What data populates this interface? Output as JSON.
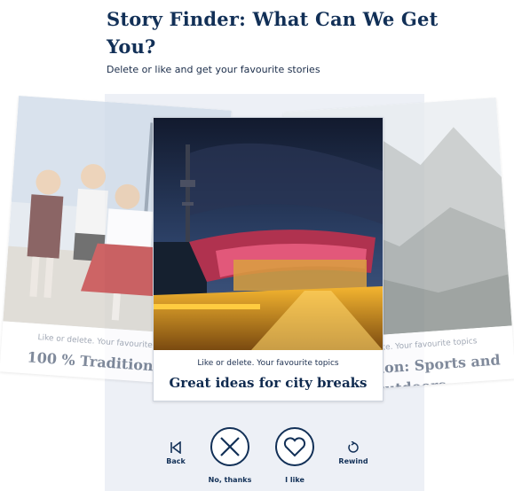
{
  "header": {
    "title": "Story Finder: What Can We Get You?",
    "subtitle": "Delete or like and get your favourite stories"
  },
  "cards": {
    "left": {
      "kicker": "Like or delete. Your favourite topics",
      "topic": "100 % Tradition"
    },
    "center": {
      "kicker": "Like or delete. Your favourite topics",
      "topic": "Great ideas for city breaks"
    },
    "right": {
      "kicker": "Like or delete. Your favourite topics",
      "topic": "Inspiration: Sports and Outdoors"
    }
  },
  "controls": {
    "back": "Back",
    "no": "No, thanks",
    "like": "I like",
    "rewind": "Rewind"
  },
  "icons": [
    "back-icon",
    "x-icon",
    "heart-icon",
    "rewind-icon"
  ],
  "colors": {
    "primary": "#123057",
    "stage": "#edf0f6"
  }
}
